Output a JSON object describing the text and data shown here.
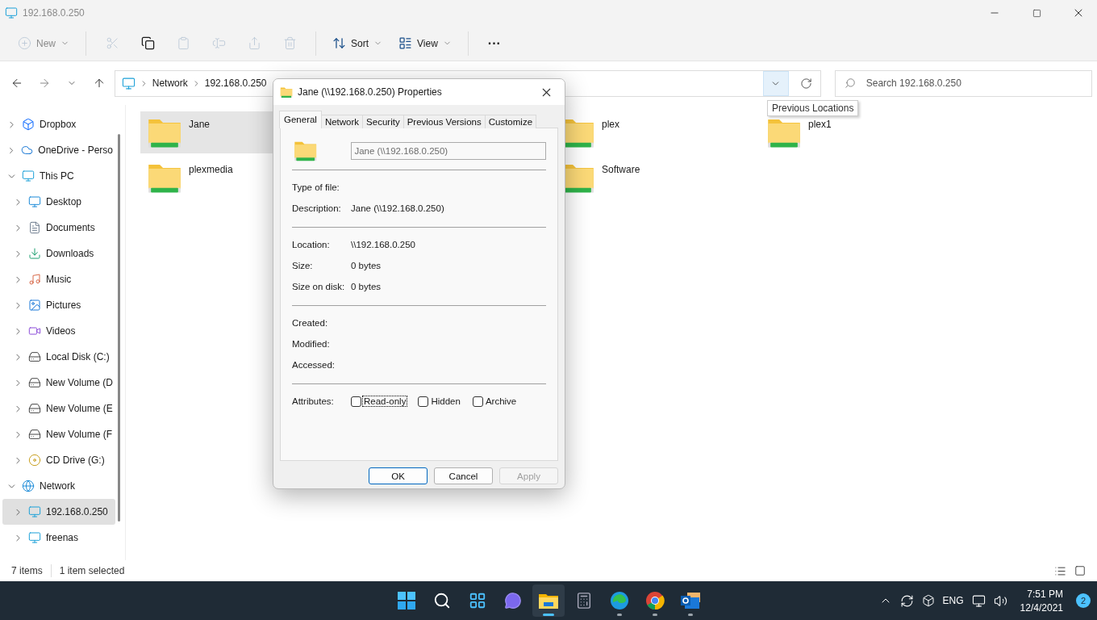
{
  "window": {
    "title": "192.168.0.250"
  },
  "commands": [
    {
      "kind": "new",
      "label": "New",
      "disabled": true
    },
    {
      "kind": "cut",
      "disabled": true
    },
    {
      "kind": "copy",
      "disabled": false
    },
    {
      "kind": "paste",
      "disabled": true
    },
    {
      "kind": "rename",
      "disabled": true
    },
    {
      "kind": "share",
      "disabled": true
    },
    {
      "kind": "delete",
      "disabled": true
    },
    {
      "kind": "sort",
      "label": "Sort",
      "disabled": false
    },
    {
      "kind": "view",
      "label": "View",
      "disabled": false
    },
    {
      "kind": "more",
      "label": "···",
      "disabled": false
    }
  ],
  "address": {
    "crumbs": [
      "Network",
      "192.168.0.250"
    ],
    "tooltip": "Previous Locations"
  },
  "search": {
    "placeholder": "Search 192.168.0.250"
  },
  "sidebar": {
    "items": [
      {
        "kind": "dropbox",
        "label": "Dropbox",
        "expanded": false,
        "selected": false
      },
      {
        "kind": "cloud",
        "label": "OneDrive - Perso",
        "expanded": false,
        "selected": false
      },
      {
        "kind": "pc",
        "label": "This PC",
        "expanded": true,
        "selected": false,
        "children": [
          {
            "kind": "desktop",
            "label": "Desktop",
            "expanded": false,
            "selected": false
          },
          {
            "kind": "documents",
            "label": "Documents",
            "expanded": false,
            "selected": false
          },
          {
            "kind": "downloads",
            "label": "Downloads",
            "expanded": false,
            "selected": false
          },
          {
            "kind": "music",
            "label": "Music",
            "expanded": false,
            "selected": false
          },
          {
            "kind": "pictures",
            "label": "Pictures",
            "expanded": false,
            "selected": false
          },
          {
            "kind": "videos",
            "label": "Videos",
            "expanded": false,
            "selected": false
          },
          {
            "kind": "disk",
            "label": "Local Disk (C:)",
            "expanded": false,
            "selected": false
          },
          {
            "kind": "volume",
            "label": "New Volume (D",
            "expanded": false,
            "selected": false
          },
          {
            "kind": "volume",
            "label": "New Volume (E",
            "expanded": false,
            "selected": false
          },
          {
            "kind": "volume",
            "label": "New Volume (F",
            "expanded": false,
            "selected": false
          },
          {
            "kind": "cd",
            "label": "CD Drive (G:)",
            "expanded": false,
            "selected": false
          }
        ]
      },
      {
        "kind": "network",
        "label": "Network",
        "expanded": true,
        "selected": false,
        "children": [
          {
            "kind": "computer",
            "label": "192.168.0.250",
            "expanded": false,
            "selected": true
          },
          {
            "kind": "computer",
            "label": "freenas",
            "expanded": false,
            "selected": false
          }
        ]
      }
    ]
  },
  "files": [
    {
      "name": "Jane",
      "selected": true
    },
    {
      "name": "plexmedia",
      "selected": false
    },
    {
      "name": "plex",
      "selected": false
    },
    {
      "name": "Software",
      "selected": false
    },
    {
      "name": "plex1",
      "selected": false
    }
  ],
  "status_bar": {
    "count": "7 items",
    "selection": "1 item selected"
  },
  "dialog": {
    "title": "Jane (\\\\192.168.0.250) Properties",
    "tabs": [
      {
        "label": "General",
        "selected": true
      },
      {
        "label": "Network",
        "selected": false
      },
      {
        "label": "Security",
        "selected": false
      },
      {
        "label": "Previous Versions",
        "selected": false
      },
      {
        "label": "Customize",
        "selected": false
      }
    ],
    "name_value": "Jane (\\\\192.168.0.250)",
    "groups": [
      [
        {
          "label": "Type of file:"
        },
        {
          "label": "Description:",
          "value": "Jane (\\\\192.168.0.250)"
        }
      ],
      [
        {
          "label": "Location:",
          "value": "\\\\192.168.0.250"
        },
        {
          "label": "Size:",
          "value": "0 bytes"
        },
        {
          "label": "Size on disk:",
          "value": "0 bytes"
        }
      ],
      [
        {
          "label": "Created:"
        },
        {
          "label": "Modified:"
        },
        {
          "label": "Accessed:"
        }
      ]
    ],
    "attributes_label": "Attributes:",
    "attributes": [
      {
        "label": "Read-only",
        "checked": false,
        "focused": true
      },
      {
        "label": "Hidden",
        "checked": false,
        "focused": false
      },
      {
        "label": "Archive",
        "checked": false,
        "focused": false
      }
    ],
    "buttons": [
      {
        "label": "OK",
        "default": true,
        "disabled": false
      },
      {
        "label": "Cancel",
        "default": false,
        "disabled": false
      },
      {
        "label": "Apply",
        "default": false,
        "disabled": true
      }
    ]
  },
  "taskbar": {
    "apps": [
      {
        "kind": "start",
        "selected": false,
        "running": false
      },
      {
        "kind": "search",
        "selected": false,
        "running": false
      },
      {
        "kind": "widgets",
        "selected": false,
        "running": false
      },
      {
        "kind": "chat",
        "selected": false,
        "running": false
      },
      {
        "kind": "explorer",
        "selected": true,
        "running": true
      },
      {
        "kind": "calculator",
        "selected": false,
        "running": false
      },
      {
        "kind": "edge",
        "selected": false,
        "running": true
      },
      {
        "kind": "chrome",
        "selected": false,
        "running": true
      },
      {
        "kind": "outlook",
        "selected": false,
        "running": true
      }
    ],
    "language": "ENG",
    "time": "7:51 PM",
    "date": "12/4/2021",
    "notifications": "2"
  }
}
